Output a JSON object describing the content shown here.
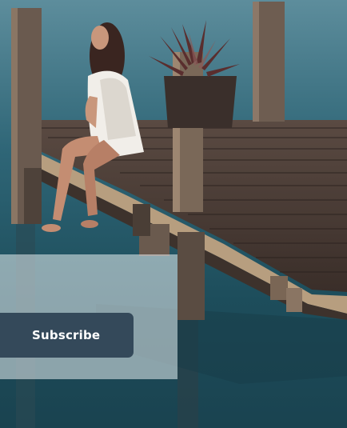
{
  "subscribe": {
    "label": "Subscribe"
  },
  "colors": {
    "button": "#34495a",
    "water": "#1f4a57",
    "dock": "#4a3a30"
  },
  "photo": {
    "icon": "dock-photo"
  }
}
